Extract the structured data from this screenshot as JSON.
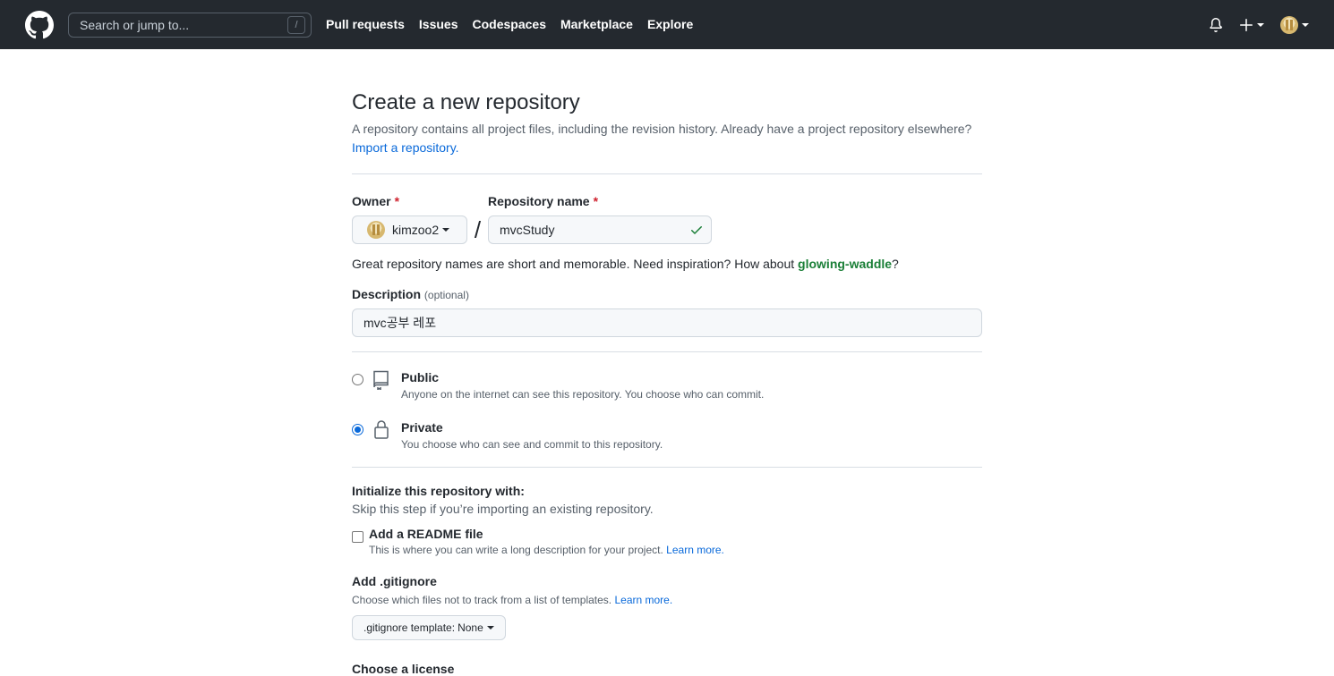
{
  "header": {
    "search_placeholder": "Search or jump to...",
    "search_shortcut": "/",
    "nav": [
      "Pull requests",
      "Issues",
      "Codespaces",
      "Marketplace",
      "Explore"
    ]
  },
  "page": {
    "title": "Create a new repository",
    "subtitle": "A repository contains all project files, including the revision history. Already have a project repository elsewhere?",
    "import_link": "Import a repository."
  },
  "form": {
    "owner_label": "Owner",
    "owner_value": "kimzoo2",
    "repo_label": "Repository name",
    "repo_value": "mvcStudy",
    "name_hint_prefix": "Great repository names are short and memorable. Need inspiration? How about",
    "name_suggestion": "glowing-waddle",
    "name_hint_suffix": "?",
    "description_label": "Description",
    "description_optional": "(optional)",
    "description_value": "mvc공부 레포",
    "visibility": {
      "public_title": "Public",
      "public_desc": "Anyone on the internet can see this repository. You choose who can commit.",
      "private_title": "Private",
      "private_desc": "You choose who can see and commit to this repository.",
      "selected": "Private"
    },
    "init_title": "Initialize this repository with:",
    "init_desc": "Skip this step if you’re importing an existing repository.",
    "readme_label": "Add a README file",
    "readme_desc": "This is where you can write a long description for your project.",
    "readme_learn_more": "Learn more.",
    "gitignore_title": "Add .gitignore",
    "gitignore_desc": "Choose which files not to track from a list of templates.",
    "gitignore_learn_more": "Learn more.",
    "gitignore_button_label": ".gitignore template:",
    "gitignore_button_value": "None",
    "license_title": "Choose a license"
  },
  "colors": {
    "header_bg": "#24292f",
    "link": "#0969da",
    "success": "#1a7f37",
    "required": "#cf222e"
  },
  "icons": [
    "github-logo-icon",
    "bell-icon",
    "plus-icon",
    "repo-icon",
    "lock-icon",
    "check-icon"
  ]
}
